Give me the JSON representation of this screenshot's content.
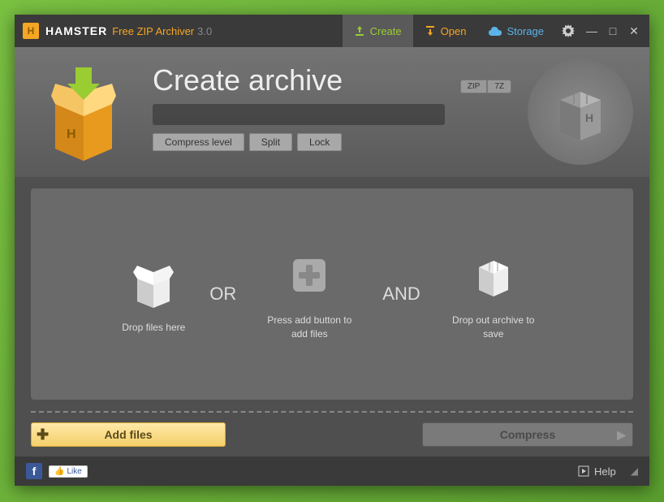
{
  "brand": {
    "logo_letter": "H",
    "name": "HAMSTER",
    "subtitle": "Free ZIP Archiver",
    "version": "3.0"
  },
  "tabs": {
    "create": "Create",
    "open": "Open",
    "storage": "Storage"
  },
  "window_controls": {
    "minimize": "—",
    "maximize": "□",
    "close": "✕"
  },
  "header": {
    "title": "Create archive",
    "compress_level": "Compress level",
    "split": "Split",
    "lock": "Lock",
    "formats": {
      "zip": "ZIP",
      "sevenz": "7Z"
    },
    "preview_letter": "H"
  },
  "dropzone": {
    "step1": "Drop files here",
    "or": "OR",
    "step2": "Press add button to add files",
    "and": "AND",
    "step3": "Drop out archive to save"
  },
  "actions": {
    "add_files": "Add files",
    "compress": "Compress"
  },
  "footer": {
    "like": "Like",
    "help": "Help"
  }
}
